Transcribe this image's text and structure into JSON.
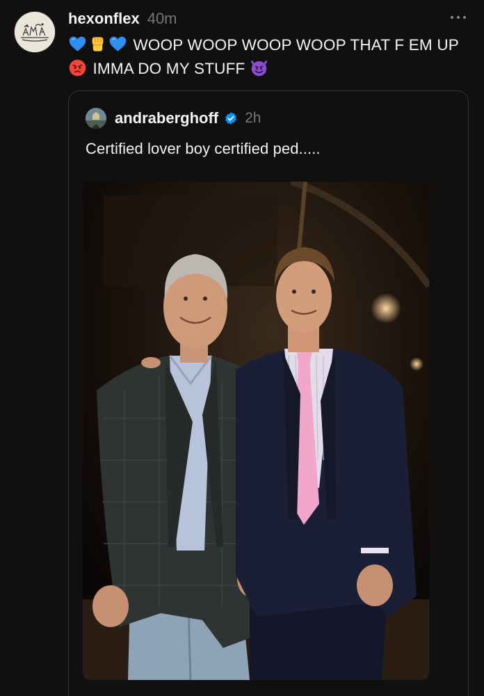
{
  "post": {
    "username": "hexonflex",
    "time": "40m",
    "text_segment_1": "WOOP WOOP WOOP WOOP THAT F EM UP",
    "text_segment_2": "IMMA DO MY STUFF",
    "emojis": [
      "blue-heart",
      "raised-fist",
      "blue-heart",
      "angry-face",
      "smiling-face-with-horns"
    ]
  },
  "quoted_post": {
    "username": "andraberghoff",
    "verified": true,
    "time": "2h",
    "text": "Certified lover boy certified ped.....",
    "photo": "photo of two men in suits posing together indoors at night"
  },
  "colors": {
    "background": "#101010",
    "text": "#f3f5f7",
    "muted": "#777777",
    "border": "#323232",
    "verified": "#0095f6"
  },
  "icons": {
    "more": "more-horizontal-icon",
    "verified": "verified-badge-icon"
  }
}
